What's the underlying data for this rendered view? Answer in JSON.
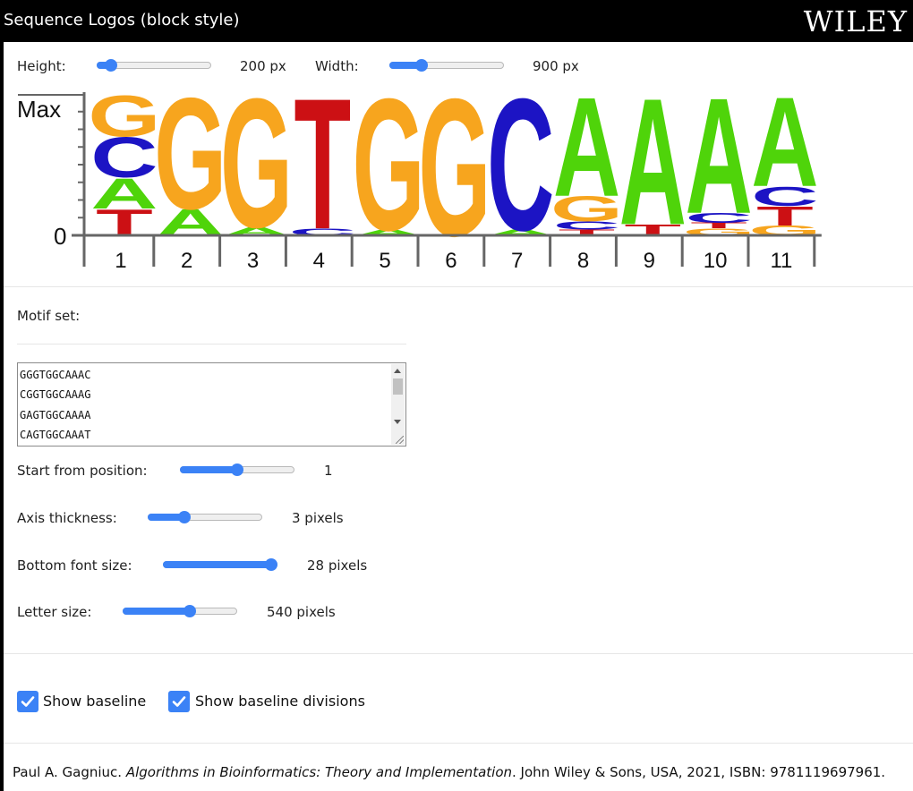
{
  "header": {
    "title": "Sequence Logos (block style)",
    "brand": "WILEY"
  },
  "controls": {
    "height": {
      "label": "Height:",
      "value": "200 px",
      "fraction": 0.08
    },
    "width": {
      "label": "Width:",
      "value": "900 px",
      "fraction": 0.25
    }
  },
  "logo": {
    "axis_max_label": "Max",
    "axis_zero_label": "0",
    "positions": [
      "1",
      "2",
      "3",
      "4",
      "5",
      "6",
      "7",
      "8",
      "9",
      "10",
      "11"
    ],
    "colors": {
      "A": "#4fd40a",
      "C": "#1c14c4",
      "G": "#f7a51e",
      "T": "#cc1014"
    }
  },
  "chart_data": {
    "type": "sequence-logo",
    "xlabel": "",
    "ylabel": "",
    "y_tick_labels": [
      "Max",
      "0"
    ],
    "positions": [
      {
        "pos": "1",
        "stack": [
          {
            "letter": "T",
            "value": 0.19
          },
          {
            "letter": "A",
            "value": 0.22
          },
          {
            "letter": "C",
            "value": 0.29
          },
          {
            "letter": "G",
            "value": 0.3
          }
        ]
      },
      {
        "pos": "2",
        "stack": [
          {
            "letter": "A",
            "value": 0.19
          },
          {
            "letter": "G",
            "value": 0.81
          }
        ]
      },
      {
        "pos": "3",
        "stack": [
          {
            "letter": "A",
            "value": 0.06
          },
          {
            "letter": "G",
            "value": 0.94
          }
        ]
      },
      {
        "pos": "4",
        "stack": [
          {
            "letter": "C",
            "value": 0.05
          },
          {
            "letter": "T",
            "value": 0.95
          }
        ]
      },
      {
        "pos": "5",
        "stack": [
          {
            "letter": "A",
            "value": 0.04
          },
          {
            "letter": "G",
            "value": 0.96
          }
        ]
      },
      {
        "pos": "6",
        "stack": [
          {
            "letter": "G",
            "value": 1.0
          }
        ]
      },
      {
        "pos": "7",
        "stack": [
          {
            "letter": "A",
            "value": 0.04
          },
          {
            "letter": "C",
            "value": 0.96
          }
        ]
      },
      {
        "pos": "8",
        "stack": [
          {
            "letter": "T",
            "value": 0.04
          },
          {
            "letter": "C",
            "value": 0.06
          },
          {
            "letter": "G",
            "value": 0.18
          },
          {
            "letter": "A",
            "value": 0.72
          }
        ]
      },
      {
        "pos": "9",
        "stack": [
          {
            "letter": "T",
            "value": 0.08
          },
          {
            "letter": "A",
            "value": 0.92
          }
        ]
      },
      {
        "pos": "10",
        "stack": [
          {
            "letter": "G",
            "value": 0.05
          },
          {
            "letter": "T",
            "value": 0.04
          },
          {
            "letter": "C",
            "value": 0.07
          },
          {
            "letter": "A",
            "value": 0.84
          }
        ]
      },
      {
        "pos": "11",
        "stack": [
          {
            "letter": "G",
            "value": 0.07
          },
          {
            "letter": "T",
            "value": 0.14
          },
          {
            "letter": "C",
            "value": 0.14
          },
          {
            "letter": "A",
            "value": 0.65
          }
        ]
      }
    ]
  },
  "motif": {
    "label": "Motif set:",
    "lines": [
      "GGGTGGCAAAC",
      "CGGTGGCAAAG",
      "GAGTGGCAAAA",
      "CAGTGGCAAAT"
    ]
  },
  "settings": {
    "start": {
      "label": "Start from position:",
      "value": "1",
      "fraction": 0.5
    },
    "axis": {
      "label": "Axis thickness:",
      "value": "3 pixels",
      "fraction": 0.3
    },
    "font": {
      "label": "Bottom font size:",
      "value": "28 pixels",
      "fraction": 1.0
    },
    "letter": {
      "label": "Letter size:",
      "value": "540 pixels",
      "fraction": 0.6
    }
  },
  "options": {
    "baseline": {
      "label": "Show baseline",
      "checked": true
    },
    "divisions": {
      "label": "Show baseline divisions",
      "checked": true
    }
  },
  "citation": {
    "author": "Paul A. Gagniuc.",
    "book": "Algorithms in Bioinformatics: Theory and Implementation",
    "rest": ". John Wiley & Sons, USA, 2021, ISBN: 9781119697961."
  }
}
